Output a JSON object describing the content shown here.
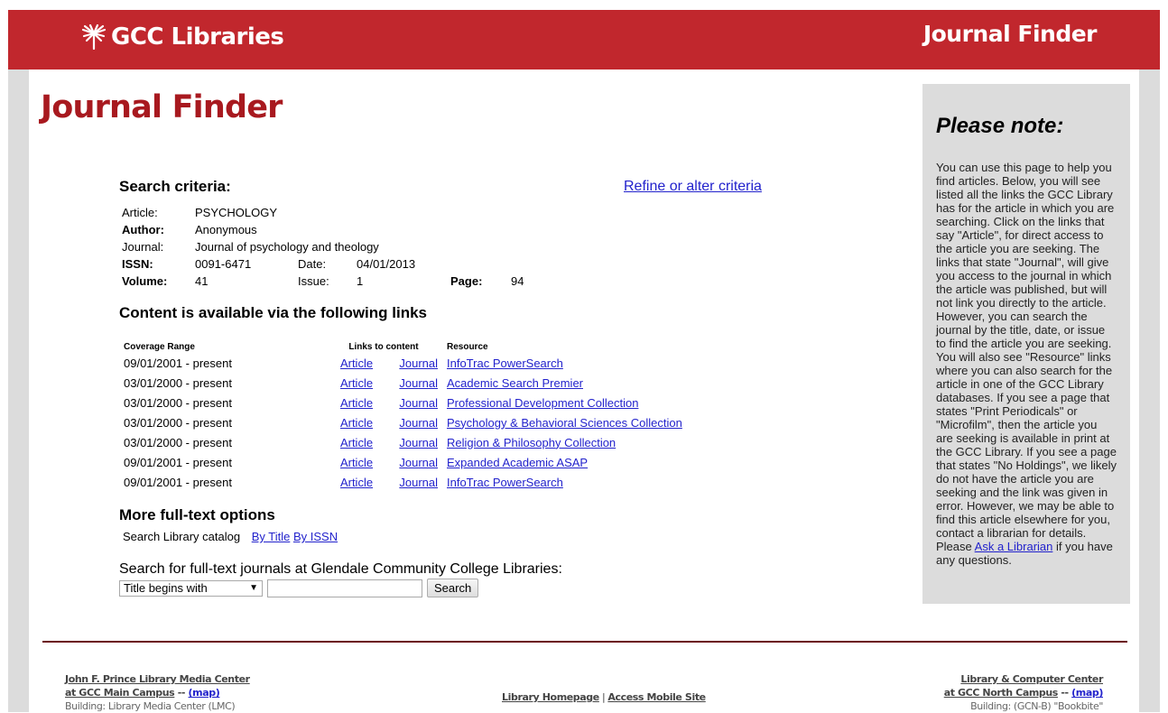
{
  "header": {
    "logo_text": "GCC Libraries",
    "logo_icon": "palm-tree-icon",
    "title": "Journal Finder",
    "brand_color": "#c1272d"
  },
  "page_title": "Journal Finder",
  "search_criteria": {
    "heading": "Search criteria:",
    "refine_link": "Refine or alter criteria",
    "article_label": "Article:",
    "article_value": "PSYCHOLOGY",
    "author_label": "Author:",
    "author_value": "Anonymous",
    "journal_label": "Journal:",
    "journal_value": "Journal of psychology and theology",
    "issn_label": "ISSN:",
    "issn_value": "0091-6471",
    "date_label": "Date:",
    "date_value": "04/01/2013",
    "volume_label": "Volume:",
    "volume_value": "41",
    "issue_label": "Issue:",
    "issue_value": "1",
    "page_label": "Page:",
    "page_value": "94"
  },
  "content_links": {
    "heading": "Content is available via the following links",
    "columns": {
      "coverage": "Coverage Range",
      "links": "Links to content",
      "resource": "Resource"
    },
    "rows": [
      {
        "coverage": "09/01/2001 - present",
        "article": "Article",
        "journal": "Journal",
        "resource": "InfoTrac PowerSearch"
      },
      {
        "coverage": "03/01/2000 - present",
        "article": "Article",
        "journal": "Journal",
        "resource": "Academic Search Premier"
      },
      {
        "coverage": "03/01/2000 - present",
        "article": "Article",
        "journal": "Journal",
        "resource": "Professional Development Collection"
      },
      {
        "coverage": "03/01/2000 - present",
        "article": "Article",
        "journal": "Journal",
        "resource": "Psychology & Behavioral Sciences Collection"
      },
      {
        "coverage": "03/01/2000 - present",
        "article": "Article",
        "journal": "Journal",
        "resource": "Religion & Philosophy Collection"
      },
      {
        "coverage": "09/01/2001 - present",
        "article": "Article",
        "journal": "Journal",
        "resource": "Expanded Academic ASAP"
      },
      {
        "coverage": "09/01/2001 - present",
        "article": "Article",
        "journal": "Journal",
        "resource": "InfoTrac PowerSearch"
      }
    ]
  },
  "more_options": {
    "heading": "More full-text options",
    "catalog_label": "Search Library catalog",
    "by_title": "By Title",
    "by_issn": "By ISSN"
  },
  "fulltext_search": {
    "label": "Search for full-text journals at Glendale Community College Libraries:",
    "select_value": "Title begins with",
    "input_value": "",
    "button_label": "Search"
  },
  "note": {
    "title": "Please note:",
    "body": "You can use this page to help you find articles. Below, you will see listed all the links the GCC Library has for the article in which you are searching. Click on the links that say \"Article\", for direct access to the article you are seeking. The links that state \"Journal\", will give you access to the journal in which the article was published, but will not link you directly to the article. However, you can search the journal by the title, date, or issue to find the article you are seeking. You will also see \"Resource\" links where you can also search for the article in one of the GCC Library databases. If you see a page that states \"Print Periodicals\" or \"Microfilm\", then the article you are seeking is available in print at the GCC Library. If you see a page that states \"No Holdings\", we likely do not have the article you are seeking and the link was given in error. However, we may be able to find this article elsewhere for you, contact a librarian for details. Please",
    "ask_link": "Ask a Librarian",
    "tail": "if you have any questions."
  },
  "footer": {
    "left_line1": "John F. Prince Library Media Center",
    "left_line2": "at GCC Main Campus",
    "left_sep": "--",
    "left_map": "(map)",
    "left_sub": "Building: Library Media Center (LMC)",
    "center_home": "Library Homepage",
    "center_sep": "|",
    "center_mobile": "Access Mobile Site",
    "right_line1": "Library & Computer Center",
    "right_line2": "at GCC North Campus",
    "right_sep": "--",
    "right_map": "(map)",
    "right_sub": "Building: (GCN-B) \"Bookbite\""
  }
}
